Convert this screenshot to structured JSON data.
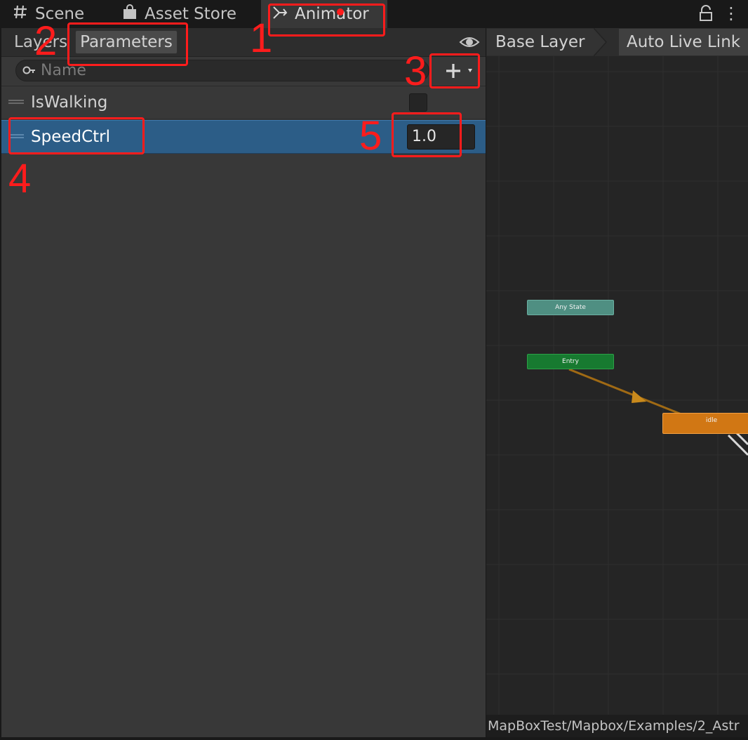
{
  "tabs": {
    "scene_label": "Scene",
    "asset_store_label": "Asset Store",
    "animator_label": "Animator"
  },
  "left_panel": {
    "layers_label": "Layers",
    "parameters_label": "Parameters",
    "search_placeholder": "Name"
  },
  "parameters": [
    {
      "name": "IsWalking",
      "type": "bool"
    },
    {
      "name": "SpeedCtrl",
      "type": "float",
      "value": "1.0"
    }
  ],
  "right_panel": {
    "breadcrumb_layer": "Base Layer",
    "auto_live_link_label": "Auto Live Link",
    "nodes": {
      "any_state": "Any State",
      "entry": "Entry",
      "idle": "idle"
    },
    "path": "MapBoxTest/Mapbox/Examples/2_Astr"
  },
  "annotations": [
    "1",
    "2",
    "3",
    "4",
    "5"
  ],
  "colors": {
    "selected_row": "#2c5d87",
    "annotation": "#ff1c1c",
    "entry_node": "#177a30",
    "any_state_node": "#4f8f82",
    "idle_node": "#d17714"
  }
}
